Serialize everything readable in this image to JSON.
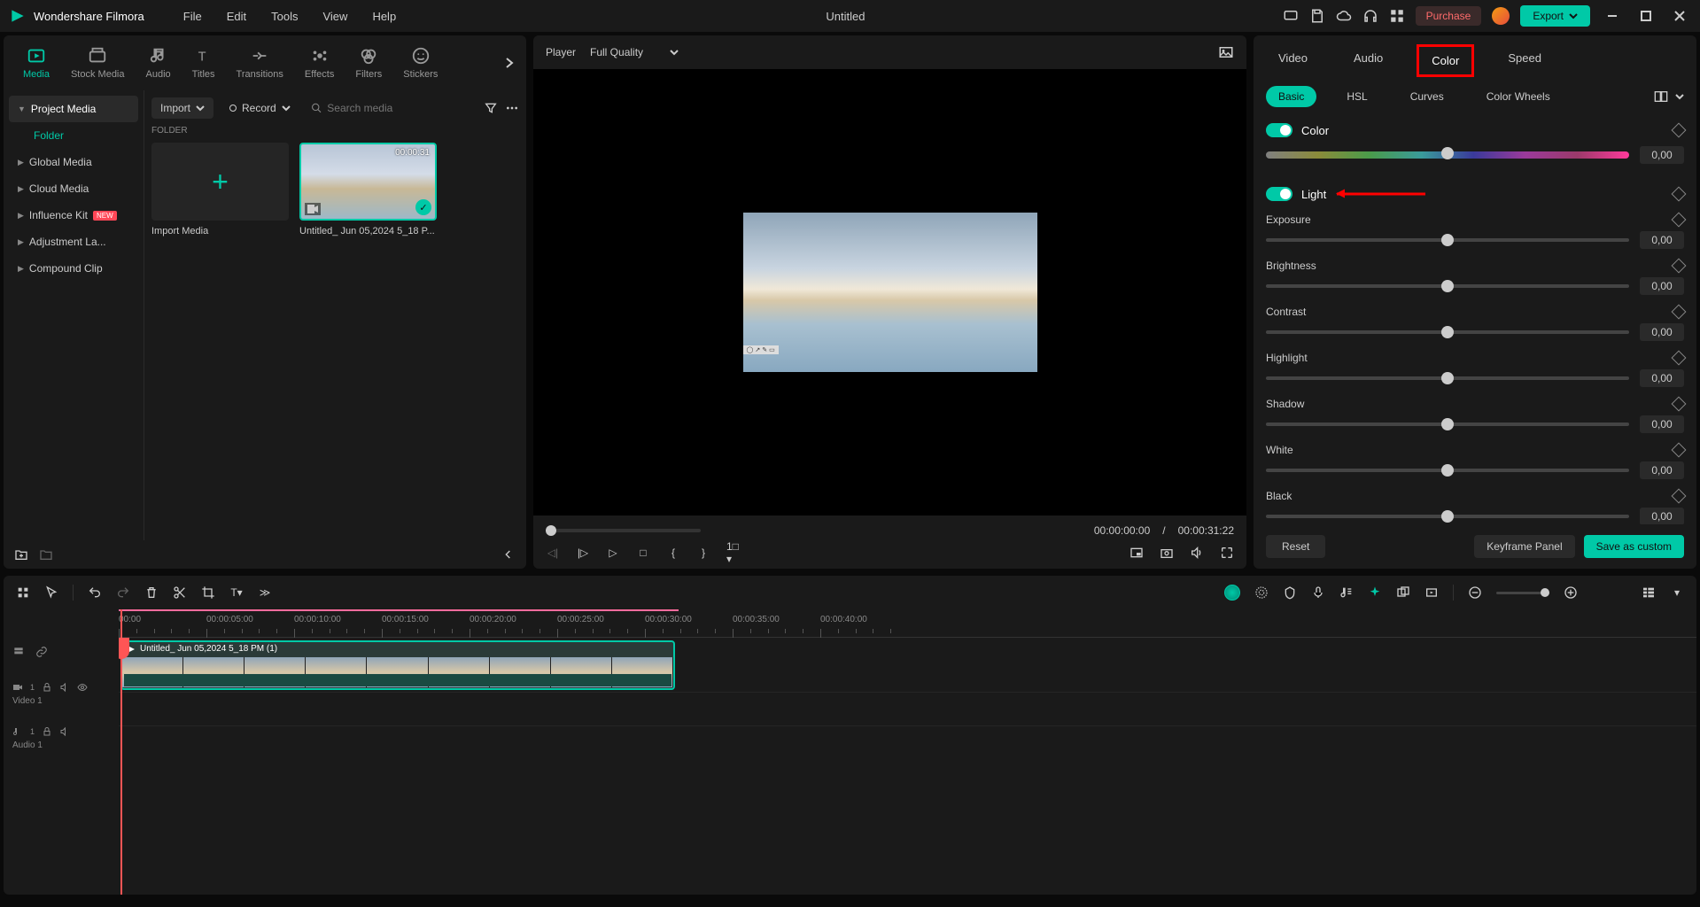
{
  "app": {
    "name": "Wondershare Filmora",
    "title": "Untitled"
  },
  "menu": [
    "File",
    "Edit",
    "Tools",
    "View",
    "Help"
  ],
  "topbar": {
    "purchase": "Purchase",
    "export": "Export"
  },
  "left": {
    "tabs": [
      "Media",
      "Stock Media",
      "Audio",
      "Titles",
      "Transitions",
      "Effects",
      "Filters",
      "Stickers"
    ],
    "sidebar": {
      "project_media": "Project Media",
      "folder": "Folder",
      "global_media": "Global Media",
      "cloud_media": "Cloud Media",
      "influence_kit": "Influence Kit",
      "new_badge": "NEW",
      "adjustment": "Adjustment La...",
      "compound": "Compound Clip"
    },
    "toolbar": {
      "import": "Import",
      "record": "Record",
      "search_placeholder": "Search media"
    },
    "folder_heading": "FOLDER",
    "import_media": "Import Media",
    "clip": {
      "duration": "00:00:31",
      "name": "Untitled_ Jun 05,2024 5_18 P..."
    }
  },
  "preview": {
    "player": "Player",
    "quality": "Full Quality",
    "current": "00:00:00:00",
    "sep": "/",
    "total": "00:00:31:22"
  },
  "right": {
    "tabs": [
      "Video",
      "Audio",
      "Color",
      "Speed"
    ],
    "active_tab": 2,
    "subtabs": [
      "Basic",
      "HSL",
      "Curves",
      "Color Wheels"
    ],
    "active_subtab": 0,
    "sections": {
      "color": "Color",
      "light": "Light"
    },
    "props": [
      {
        "label": "Exposure",
        "value": "0,00"
      },
      {
        "label": "Brightness",
        "value": "0,00"
      },
      {
        "label": "Contrast",
        "value": "0,00"
      },
      {
        "label": "Highlight",
        "value": "0,00"
      },
      {
        "label": "Shadow",
        "value": "0,00"
      },
      {
        "label": "White",
        "value": "0,00"
      },
      {
        "label": "Black",
        "value": "0,00"
      }
    ],
    "color_value": "0,00",
    "footer": {
      "reset": "Reset",
      "keyframe": "Keyframe Panel",
      "save": "Save as custom"
    }
  },
  "timeline": {
    "ruler": [
      "00:00",
      "00:00:05:00",
      "00:00:10:00",
      "00:00:15:00",
      "00:00:20:00",
      "00:00:25:00",
      "00:00:30:00",
      "00:00:35:00",
      "00:00:40:00"
    ],
    "video_track": "Video 1",
    "audio_track": "Audio 1",
    "clip_name": "Untitled_ Jun 05,2024 5_18 PM (1)"
  }
}
